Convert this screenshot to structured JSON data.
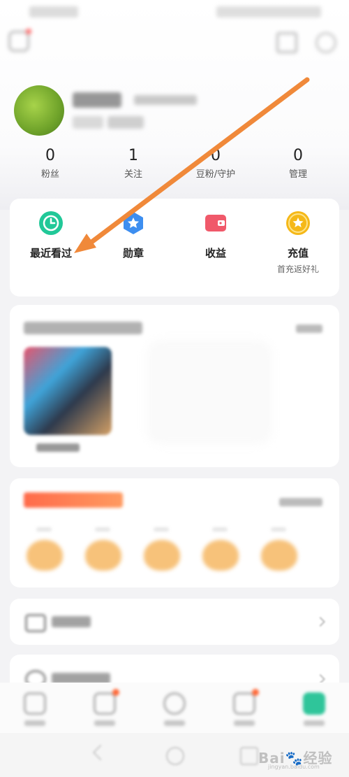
{
  "profile": {
    "stats": [
      {
        "number": "0",
        "label": "粉丝"
      },
      {
        "number": "1",
        "label": "关注"
      },
      {
        "number": "0",
        "label": "豆粉/守护"
      },
      {
        "number": "0",
        "label": "管理"
      }
    ]
  },
  "quick_actions": [
    {
      "label": "最近看过",
      "icon": "clock-icon",
      "color": "#21c898"
    },
    {
      "label": "勋章",
      "icon": "star-badge-icon",
      "color": "#3d8ef0"
    },
    {
      "label": "收益",
      "icon": "wallet-icon",
      "color": "#f0596a"
    },
    {
      "label": "充值",
      "icon": "star-coin-icon",
      "color": "#f5b818",
      "sub": "首充返好礼"
    }
  ],
  "watermark": {
    "brand": "Bai",
    "suffix": "经验",
    "url": "jingyan.baidu.com"
  },
  "annotation": {
    "arrow_color": "#f0893a"
  }
}
